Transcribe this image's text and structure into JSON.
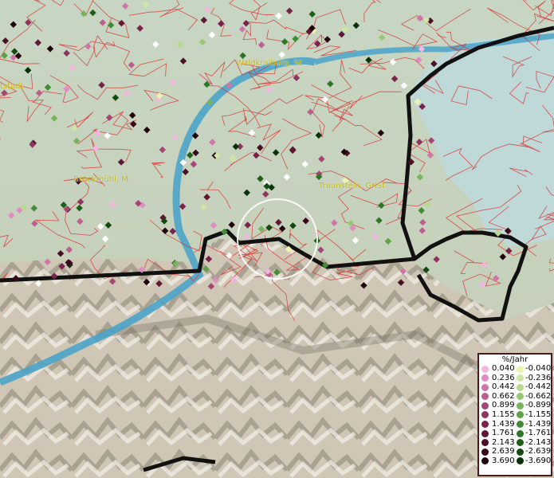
{
  "map": {
    "towns": [
      "Waldkraiburg, St",
      "Bruckmühl, M",
      "Traunstein, GKSt",
      "tstadt"
    ]
  },
  "legend": {
    "title": "%/Jahr",
    "rows": [
      {
        "pos": "0.040",
        "neg": "-0.040",
        "pc": "#f2b6df",
        "nc": "#edf3b0"
      },
      {
        "pos": "0.236",
        "neg": "-0.236",
        "pc": "#df8cc2",
        "nc": "#cfe7a3"
      },
      {
        "pos": "0.442",
        "neg": "-0.442",
        "pc": "#cf76a8",
        "nc": "#b6d98d"
      },
      {
        "pos": "0.662",
        "neg": "-0.662",
        "pc": "#bd5f8e",
        "nc": "#98c873"
      },
      {
        "pos": "0.899",
        "neg": "-0.899",
        "pc": "#a54775",
        "nc": "#79b45c"
      },
      {
        "pos": "1.155",
        "neg": "-1.155",
        "pc": "#8f345f",
        "nc": "#5ea247"
      },
      {
        "pos": "1.439",
        "neg": "-1.439",
        "pc": "#78234b",
        "nc": "#438c35"
      },
      {
        "pos": "1.761",
        "neg": "-1.761",
        "pc": "#601837",
        "nc": "#2f7626"
      },
      {
        "pos": "2.143",
        "neg": "-2.143",
        "pc": "#4b0f26",
        "nc": "#1e5f19"
      },
      {
        "pos": "2.639",
        "neg": "-2.639",
        "pc": "#36081a",
        "nc": "#124a10"
      },
      {
        "pos": "3.690",
        "neg": "-3.690",
        "pc": "#22040e",
        "nc": "#083207"
      }
    ]
  }
}
